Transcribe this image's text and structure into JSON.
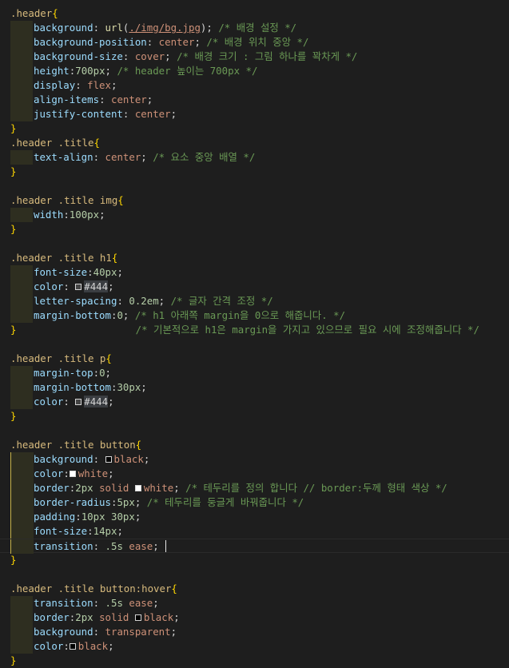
{
  "colors": {
    "background": "#1e1e1e",
    "selector": "#d7ba7d",
    "brace": "#ffd700",
    "property": "#9cdcfe",
    "value": "#ce9178",
    "number": "#b5cea8",
    "comment": "#6a9955",
    "punct": "#d4d4d4",
    "func": "#dcdcaa"
  },
  "lines": [
    {
      "guide": 0,
      "tokens": [
        [
          "sel",
          ".header"
        ],
        [
          "brace",
          "{"
        ]
      ]
    },
    {
      "guide": 1,
      "tokens": [
        [
          "prop",
          "background"
        ],
        [
          "p",
          ": "
        ],
        [
          "fn",
          "url"
        ],
        [
          "p",
          "("
        ],
        [
          "url",
          "./img/bg.jpg"
        ],
        [
          "p",
          "); "
        ],
        [
          "cmt",
          "/* 배경 설정 */"
        ]
      ]
    },
    {
      "guide": 1,
      "tokens": [
        [
          "prop",
          "background-position"
        ],
        [
          "p",
          ": "
        ],
        [
          "val",
          "center"
        ],
        [
          "p",
          "; "
        ],
        [
          "cmt",
          "/* 배경 위치 중앙 */"
        ]
      ]
    },
    {
      "guide": 1,
      "tokens": [
        [
          "prop",
          "background-size"
        ],
        [
          "p",
          ": "
        ],
        [
          "val",
          "cover"
        ],
        [
          "p",
          "; "
        ],
        [
          "cmt",
          "/* 배경 크기 : 그림 하나를 꽉차게 */"
        ]
      ]
    },
    {
      "guide": 1,
      "tokens": [
        [
          "prop",
          "height"
        ],
        [
          "p",
          ":"
        ],
        [
          "num",
          "700px"
        ],
        [
          "p",
          "; "
        ],
        [
          "cmt",
          "/* header 높이는 700px */"
        ]
      ]
    },
    {
      "guide": 1,
      "tokens": [
        [
          "prop",
          "display"
        ],
        [
          "p",
          ": "
        ],
        [
          "val",
          "flex"
        ],
        [
          "p",
          ";"
        ]
      ]
    },
    {
      "guide": 1,
      "tokens": [
        [
          "prop",
          "align-items"
        ],
        [
          "p",
          ": "
        ],
        [
          "val",
          "center"
        ],
        [
          "p",
          ";"
        ]
      ]
    },
    {
      "guide": 1,
      "tokens": [
        [
          "prop",
          "justify-content"
        ],
        [
          "p",
          ": "
        ],
        [
          "val",
          "center"
        ],
        [
          "p",
          ";"
        ]
      ]
    },
    {
      "guide": 0,
      "tokens": [
        [
          "brace",
          "}"
        ]
      ]
    },
    {
      "guide": 0,
      "tokens": [
        [
          "sel",
          ".header .title"
        ],
        [
          "brace",
          "{"
        ]
      ]
    },
    {
      "guide": 1,
      "tokens": [
        [
          "prop",
          "text-align"
        ],
        [
          "p",
          ": "
        ],
        [
          "val",
          "center"
        ],
        [
          "p",
          "; "
        ],
        [
          "cmt",
          "/* 요소 중앙 배열 */"
        ]
      ]
    },
    {
      "guide": 0,
      "tokens": [
        [
          "brace",
          "}"
        ]
      ]
    },
    {
      "guide": 0,
      "tokens": []
    },
    {
      "guide": 0,
      "tokens": [
        [
          "sel",
          ".header .title img"
        ],
        [
          "brace",
          "{"
        ]
      ]
    },
    {
      "guide": 1,
      "tokens": [
        [
          "prop",
          "width"
        ],
        [
          "p",
          ":"
        ],
        [
          "num",
          "100px"
        ],
        [
          "p",
          ";"
        ]
      ]
    },
    {
      "guide": 0,
      "tokens": [
        [
          "brace",
          "}"
        ]
      ]
    },
    {
      "guide": 0,
      "tokens": []
    },
    {
      "guide": 0,
      "tokens": [
        [
          "sel",
          ".header .title h1"
        ],
        [
          "brace",
          "{"
        ]
      ]
    },
    {
      "guide": 1,
      "tokens": [
        [
          "prop",
          "font-size"
        ],
        [
          "p",
          ":"
        ],
        [
          "num",
          "40px"
        ],
        [
          "p",
          ";"
        ]
      ]
    },
    {
      "guide": 1,
      "tokens": [
        [
          "prop",
          "color"
        ],
        [
          "p",
          ": "
        ],
        [
          "sw",
          "#444444"
        ],
        [
          "hex",
          "#444"
        ],
        [
          "p",
          ";"
        ]
      ]
    },
    {
      "guide": 1,
      "tokens": [
        [
          "prop",
          "letter-spacing"
        ],
        [
          "p",
          ": "
        ],
        [
          "num",
          "0.2em"
        ],
        [
          "p",
          "; "
        ],
        [
          "cmt",
          "/* 글자 간격 조정 */"
        ]
      ]
    },
    {
      "guide": 1,
      "tokens": [
        [
          "prop",
          "margin-bottom"
        ],
        [
          "p",
          ":"
        ],
        [
          "num",
          "0"
        ],
        [
          "p",
          "; "
        ],
        [
          "cmt",
          "/* h1 아래쪽 margin을 0으로 해줍니다. */"
        ]
      ]
    },
    {
      "guide": 0,
      "tokens": [
        [
          "brace",
          "}"
        ],
        [
          "p",
          "                    "
        ],
        [
          "cmt",
          "/* 기본적으로 h1은 margin을 가지고 있으므로 필요 시에 조정해줍니다 */"
        ]
      ]
    },
    {
      "guide": 0,
      "tokens": []
    },
    {
      "guide": 0,
      "tokens": [
        [
          "sel",
          ".header .title p"
        ],
        [
          "brace",
          "{"
        ]
      ]
    },
    {
      "guide": 1,
      "tokens": [
        [
          "prop",
          "margin-top"
        ],
        [
          "p",
          ":"
        ],
        [
          "num",
          "0"
        ],
        [
          "p",
          ";"
        ]
      ]
    },
    {
      "guide": 1,
      "tokens": [
        [
          "prop",
          "margin-bottom"
        ],
        [
          "p",
          ":"
        ],
        [
          "num",
          "30px"
        ],
        [
          "p",
          ";"
        ]
      ]
    },
    {
      "guide": 1,
      "tokens": [
        [
          "prop",
          "color"
        ],
        [
          "p",
          ": "
        ],
        [
          "sw",
          "#444444"
        ],
        [
          "hex",
          "#444"
        ],
        [
          "p",
          ";"
        ]
      ]
    },
    {
      "guide": 0,
      "tokens": [
        [
          "brace",
          "}"
        ]
      ]
    },
    {
      "guide": 0,
      "tokens": []
    },
    {
      "guide": 0,
      "tokens": [
        [
          "sel",
          ".header .title button"
        ],
        [
          "brace",
          "{"
        ]
      ]
    },
    {
      "guide": 2,
      "tokens": [
        [
          "prop",
          "background"
        ],
        [
          "p",
          ": "
        ],
        [
          "sw",
          "#000000"
        ],
        [
          "val",
          "black"
        ],
        [
          "p",
          ";"
        ]
      ]
    },
    {
      "guide": 2,
      "tokens": [
        [
          "prop",
          "color"
        ],
        [
          "p",
          ":"
        ],
        [
          "sw",
          "#ffffff"
        ],
        [
          "val",
          "white"
        ],
        [
          "p",
          ";"
        ]
      ]
    },
    {
      "guide": 2,
      "tokens": [
        [
          "prop",
          "border"
        ],
        [
          "p",
          ":"
        ],
        [
          "num",
          "2px"
        ],
        [
          "p",
          " "
        ],
        [
          "val",
          "solid"
        ],
        [
          "p",
          " "
        ],
        [
          "sw",
          "#ffffff"
        ],
        [
          "val",
          "white"
        ],
        [
          "p",
          "; "
        ],
        [
          "cmt",
          "/* 테두리를 정의 합니다 // border:두께 형태 색상 */"
        ]
      ]
    },
    {
      "guide": 2,
      "tokens": [
        [
          "prop",
          "border-radius"
        ],
        [
          "p",
          ":"
        ],
        [
          "num",
          "5px"
        ],
        [
          "p",
          "; "
        ],
        [
          "cmt",
          "/* 테두리를 둥글게 바꿔줍니다 */"
        ]
      ]
    },
    {
      "guide": 2,
      "tokens": [
        [
          "prop",
          "padding"
        ],
        [
          "p",
          ":"
        ],
        [
          "num",
          "10px"
        ],
        [
          "p",
          " "
        ],
        [
          "num",
          "30px"
        ],
        [
          "p",
          ";"
        ]
      ]
    },
    {
      "guide": 2,
      "tokens": [
        [
          "prop",
          "font-size"
        ],
        [
          "p",
          ":"
        ],
        [
          "num",
          "14px"
        ],
        [
          "p",
          ";"
        ]
      ]
    },
    {
      "guide": 2,
      "active": true,
      "tokens": [
        [
          "prop",
          "transition"
        ],
        [
          "p",
          ": "
        ],
        [
          "num",
          ".5s"
        ],
        [
          "p",
          " "
        ],
        [
          "val",
          "ease"
        ],
        [
          "p",
          "; "
        ],
        [
          "cursor",
          ""
        ]
      ]
    },
    {
      "guide": 0,
      "tokens": [
        [
          "brace",
          "}"
        ]
      ]
    },
    {
      "guide": 0,
      "tokens": []
    },
    {
      "guide": 0,
      "tokens": [
        [
          "sel",
          ".header .title button:hover"
        ],
        [
          "brace",
          "{"
        ]
      ]
    },
    {
      "guide": 1,
      "tokens": [
        [
          "prop",
          "transition"
        ],
        [
          "p",
          ": "
        ],
        [
          "num",
          ".5s"
        ],
        [
          "p",
          " "
        ],
        [
          "val",
          "ease"
        ],
        [
          "p",
          ";"
        ]
      ]
    },
    {
      "guide": 1,
      "tokens": [
        [
          "prop",
          "border"
        ],
        [
          "p",
          ":"
        ],
        [
          "num",
          "2px"
        ],
        [
          "p",
          " "
        ],
        [
          "val",
          "solid"
        ],
        [
          "p",
          " "
        ],
        [
          "sw",
          "#000000"
        ],
        [
          "val",
          "black"
        ],
        [
          "p",
          ";"
        ]
      ]
    },
    {
      "guide": 1,
      "tokens": [
        [
          "prop",
          "background"
        ],
        [
          "p",
          ": "
        ],
        [
          "val",
          "transparent"
        ],
        [
          "p",
          ";"
        ]
      ]
    },
    {
      "guide": 1,
      "tokens": [
        [
          "prop",
          "color"
        ],
        [
          "p",
          ":"
        ],
        [
          "sw",
          "#000000"
        ],
        [
          "val",
          "black"
        ],
        [
          "p",
          ";"
        ]
      ]
    },
    {
      "guide": 0,
      "tokens": [
        [
          "brace",
          "}"
        ]
      ]
    }
  ]
}
